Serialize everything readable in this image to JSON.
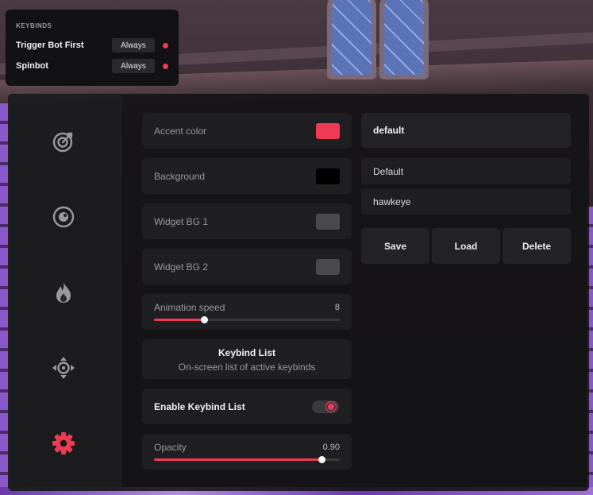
{
  "theme": {
    "accent": "#f03a54",
    "background": "#000000",
    "widget_bg_1": "#4a4a4e",
    "widget_bg_2": "#4a4a4e"
  },
  "keybinds": {
    "title": "KEYBINDS",
    "items": [
      {
        "name": "Trigger Bot First",
        "mode": "Always",
        "active": true
      },
      {
        "name": "Spinbot",
        "mode": "Always",
        "active": true
      }
    ]
  },
  "sidebar": {
    "items": [
      {
        "icon": "crosshair-target-icon",
        "active": false
      },
      {
        "icon": "eye-icon",
        "active": false
      },
      {
        "icon": "flame-icon",
        "active": false
      },
      {
        "icon": "move-arrows-icon",
        "active": false
      },
      {
        "icon": "gear-icon",
        "active": true
      }
    ]
  },
  "settings": {
    "accent_color_label": "Accent color",
    "background_label": "Background",
    "widget_bg1_label": "Widget BG 1",
    "widget_bg2_label": "Widget BG 2",
    "animation_speed": {
      "label": "Animation speed",
      "value": "8",
      "fraction": 0.27
    },
    "keybind_list": {
      "title": "Keybind List",
      "subtitle": "On-screen list of active keybinds"
    },
    "enable_keybind_list": {
      "label": "Enable Keybind List",
      "enabled": true
    },
    "opacity": {
      "label": "Opacity",
      "value": "0.90",
      "fraction": 0.9
    }
  },
  "configs": {
    "name_input_value": "default",
    "list": [
      "Default",
      "hawkeye"
    ],
    "save_label": "Save",
    "load_label": "Load",
    "delete_label": "Delete"
  }
}
